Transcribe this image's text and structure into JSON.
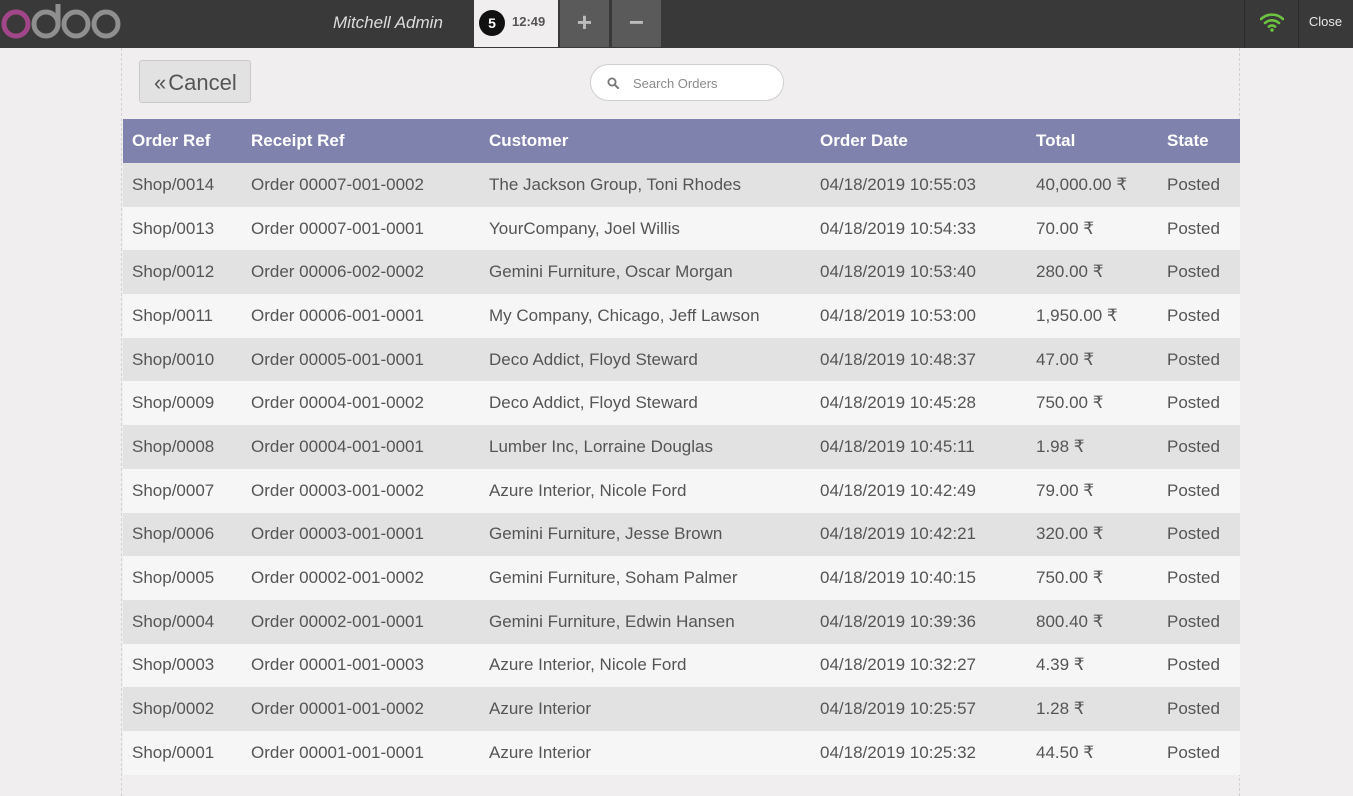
{
  "header": {
    "user_name": "Mitchell Admin",
    "order_tab": {
      "number": "5",
      "time": "12:49"
    },
    "add_label": "+",
    "remove_label": "−",
    "close_label": "Close",
    "logo_icon": "odoo-logo",
    "wifi_icon": "wifi-icon",
    "wifi_color": "#6ec440"
  },
  "toolbar": {
    "cancel_label": "Cancel",
    "search_placeholder": "Search Orders"
  },
  "table": {
    "columns": [
      "Order Ref",
      "Receipt Ref",
      "Customer",
      "Order Date",
      "Total",
      "State"
    ],
    "header_color": "#7f82ac",
    "rows": [
      [
        "Shop/0014",
        "Order 00007-001-0002",
        "The Jackson Group, Toni Rhodes",
        "04/18/2019 10:55:03",
        "40,000.00 ₹",
        "Posted"
      ],
      [
        "Shop/0013",
        "Order 00007-001-0001",
        "YourCompany, Joel Willis",
        "04/18/2019 10:54:33",
        "70.00 ₹",
        "Posted"
      ],
      [
        "Shop/0012",
        "Order 00006-002-0002",
        "Gemini Furniture, Oscar Morgan",
        "04/18/2019 10:53:40",
        "280.00 ₹",
        "Posted"
      ],
      [
        "Shop/0011",
        "Order 00006-001-0001",
        "My Company, Chicago, Jeff Lawson",
        "04/18/2019 10:53:00",
        "1,950.00 ₹",
        "Posted"
      ],
      [
        "Shop/0010",
        "Order 00005-001-0001",
        "Deco Addict, Floyd Steward",
        "04/18/2019 10:48:37",
        "47.00 ₹",
        "Posted"
      ],
      [
        "Shop/0009",
        "Order 00004-001-0002",
        "Deco Addict, Floyd Steward",
        "04/18/2019 10:45:28",
        "750.00 ₹",
        "Posted"
      ],
      [
        "Shop/0008",
        "Order 00004-001-0001",
        "Lumber Inc, Lorraine Douglas",
        "04/18/2019 10:45:11",
        "1.98 ₹",
        "Posted"
      ],
      [
        "Shop/0007",
        "Order 00003-001-0002",
        "Azure Interior, Nicole Ford",
        "04/18/2019 10:42:49",
        "79.00 ₹",
        "Posted"
      ],
      [
        "Shop/0006",
        "Order 00003-001-0001",
        "Gemini Furniture, Jesse Brown",
        "04/18/2019 10:42:21",
        "320.00 ₹",
        "Posted"
      ],
      [
        "Shop/0005",
        "Order 00002-001-0002",
        "Gemini Furniture, Soham Palmer",
        "04/18/2019 10:40:15",
        "750.00 ₹",
        "Posted"
      ],
      [
        "Shop/0004",
        "Order 00002-001-0001",
        "Gemini Furniture, Edwin Hansen",
        "04/18/2019 10:39:36",
        "800.40 ₹",
        "Posted"
      ],
      [
        "Shop/0003",
        "Order 00001-001-0003",
        "Azure Interior, Nicole Ford",
        "04/18/2019 10:32:27",
        "4.39 ₹",
        "Posted"
      ],
      [
        "Shop/0002",
        "Order 00001-001-0002",
        "Azure Interior",
        "04/18/2019 10:25:57",
        "1.28 ₹",
        "Posted"
      ],
      [
        "Shop/0001",
        "Order 00001-001-0001",
        "Azure Interior",
        "04/18/2019 10:25:32",
        "44.50 ₹",
        "Posted"
      ]
    ]
  }
}
